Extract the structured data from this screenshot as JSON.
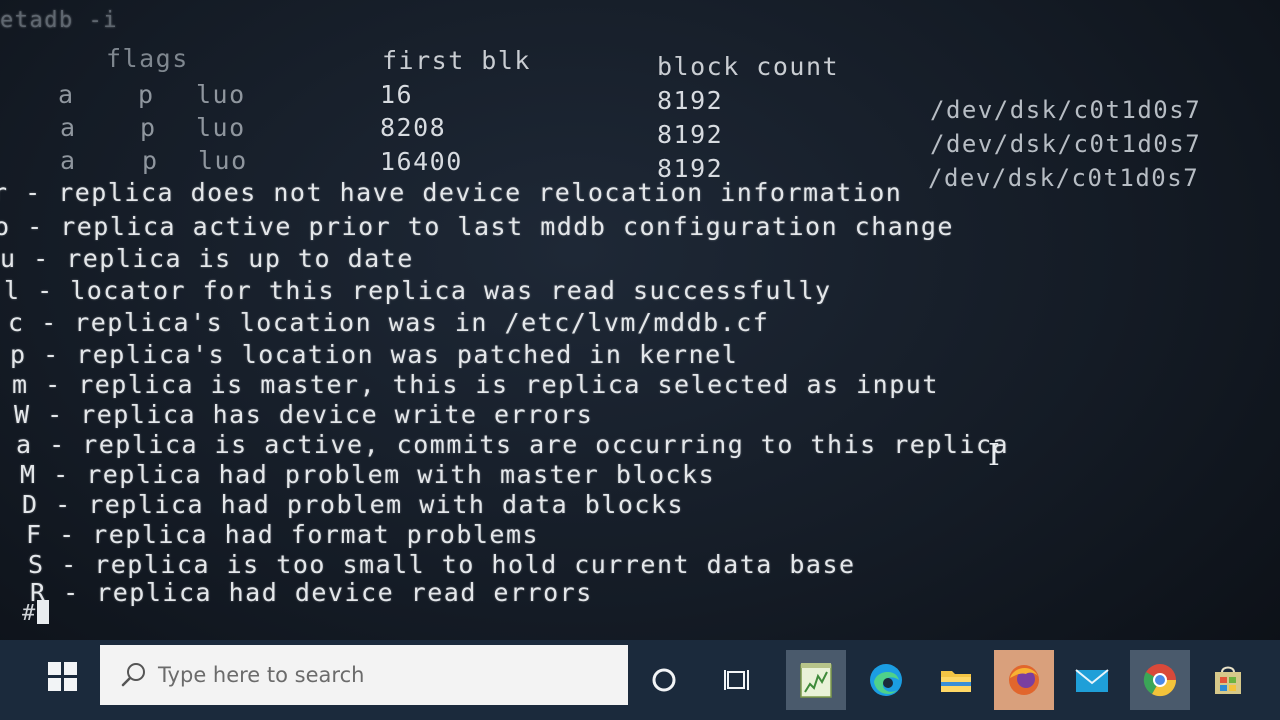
{
  "terminal": {
    "command_fragment": "etadb -i",
    "table_header": {
      "flags": "flags",
      "first_blk": "first blk",
      "block_count": "block count"
    },
    "rows": [
      {
        "flag1": "a",
        "flag2": "p",
        "flag3": "luo",
        "first_blk": "16",
        "block_count": "8192",
        "device": "/dev/dsk/c0t1d0s7"
      },
      {
        "flag1": "a",
        "flag2": "p",
        "flag3": "luo",
        "first_blk": "8208",
        "block_count": "8192",
        "device": "/dev/dsk/c0t1d0s7"
      },
      {
        "flag1": "a",
        "flag2": "p",
        "flag3": "luo",
        "first_blk": "16400",
        "block_count": "8192",
        "device": "/dev/dsk/c0t1d0s7"
      }
    ],
    "legend": [
      "r - replica does not have device relocation information",
      "o - replica active prior to last mddb configuration change",
      "u - replica is up to date",
      "l - locator for this replica was read successfully",
      "c - replica's location was in /etc/lvm/mddb.cf",
      "p - replica's location was patched in kernel",
      "m - replica is master, this is replica selected as input",
      "W - replica has device write errors",
      "a - replica is active, commits are occurring to this replica",
      "M - replica had problem with master blocks",
      "D - replica had problem with data blocks",
      "F - replica had format problems",
      "S - replica is too small to hold current data base",
      "R - replica had device read errors"
    ],
    "prompt": "#"
  },
  "taskbar": {
    "search_placeholder": "Type here to search",
    "icons": [
      "windows-start-icon",
      "search-icon",
      "cortana-icon",
      "task-view-icon",
      "notepad-chart-icon",
      "edge-icon",
      "file-explorer-icon",
      "firefox-icon",
      "mail-icon",
      "chrome-icon",
      "store-icon"
    ]
  }
}
